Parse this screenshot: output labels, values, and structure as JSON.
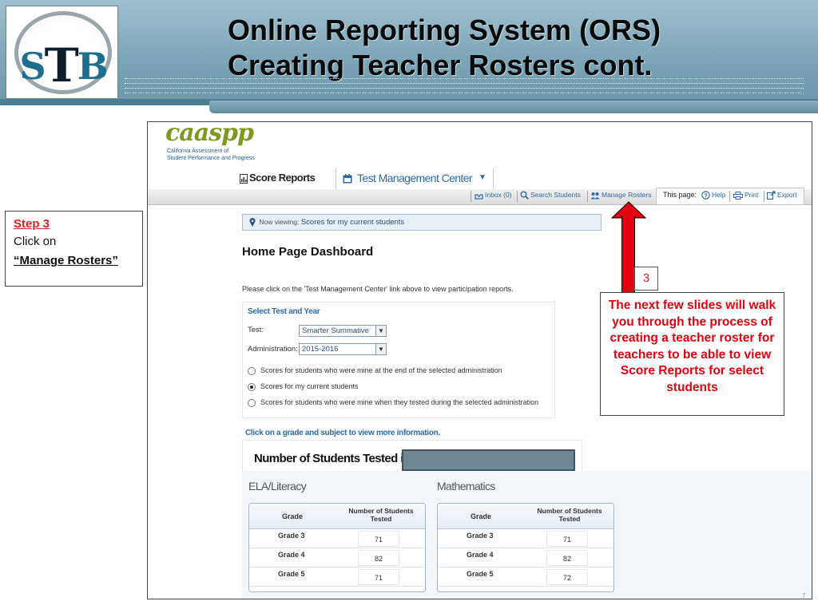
{
  "slide": {
    "title_line1": "Online Reporting System (ORS)",
    "title_line2": "Creating Teacher Rosters  cont.",
    "logo_text_left": "S",
    "logo_text_mid": "T",
    "logo_text_right": "B",
    "page_number": "7"
  },
  "step": {
    "title": "Step 3",
    "line1": "Click on",
    "line2": "“Manage Rosters”"
  },
  "annotation": {
    "number": "3",
    "note": "The next few slides will walk you through the process of creating a teacher roster for teachers to be able to view Score Reports for select students"
  },
  "ors": {
    "logo": "caaspp",
    "logo_sub1": "California Assessment of",
    "logo_sub2": "Student Performance and Progress",
    "nav": {
      "score_reports": "Score Reports",
      "test_management_center": "Test Management Center"
    },
    "toolbar": {
      "inbox": "Inbox (0)",
      "search_students": "Search Students",
      "manage_rosters": "Manage Rosters",
      "this_page": "This page:",
      "help": "Help",
      "print": "Print",
      "export": "Export"
    },
    "now_viewing_label": "Now viewing:",
    "now_viewing_value": "Scores for my current students",
    "heading": "Home Page Dashboard",
    "instruction": "Please click on the 'Test Management Center' link above to view participation reports.",
    "select_panel": {
      "heading": "Select Test and Year",
      "test_label": "Test:",
      "test_value": "Smarter Summative",
      "admin_label": "Administration:",
      "admin_value": "2015-2016",
      "options": [
        "Scores for students who were mine at the end of the selected administration",
        "Scores for my current students",
        "Scores for students who were mine when they tested during the selected administration"
      ],
      "selected_option": 1
    },
    "click_hint": "Click on a grade and subject to view more information.",
    "students_tested_title": "Number of Students Tested i",
    "tables": [
      {
        "subject": "ELA/Literacy",
        "col_grade": "Grade",
        "col_count_1": "Number of Students",
        "col_count_2": "Tested",
        "rows": [
          {
            "grade": "Grade 3",
            "count": "71"
          },
          {
            "grade": "Grade 4",
            "count": "82"
          },
          {
            "grade": "Grade 5",
            "count": "71"
          }
        ]
      },
      {
        "subject": "Mathematics",
        "col_grade": "Grade",
        "col_count_1": "Number of Students",
        "col_count_2": "Tested",
        "rows": [
          {
            "grade": "Grade 3",
            "count": "71"
          },
          {
            "grade": "Grade 4",
            "count": "82"
          },
          {
            "grade": "Grade 5",
            "count": "72"
          }
        ]
      }
    ]
  },
  "colors": {
    "header_blue": "#7ea7b9",
    "link_blue": "#2b6aa8",
    "annotation_red": "#e3000f",
    "caaspp_green": "#7c9a1e"
  }
}
